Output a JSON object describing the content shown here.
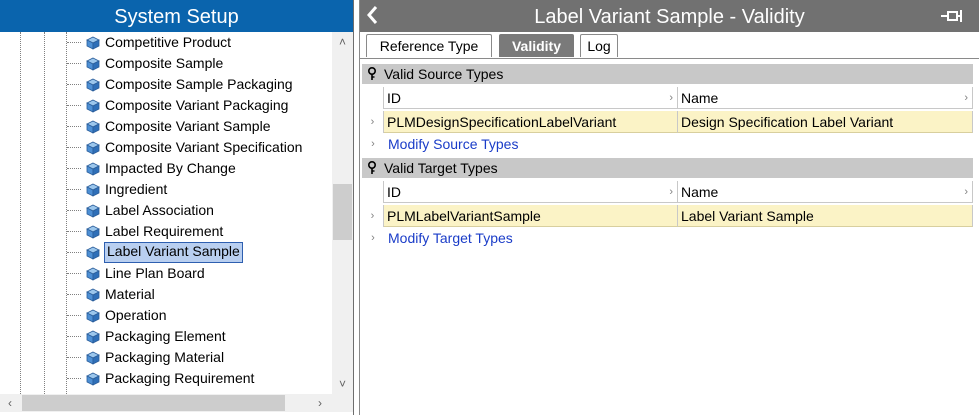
{
  "left_panel": {
    "title": "System Setup",
    "tree_items": [
      {
        "label": "Competitive Product"
      },
      {
        "label": "Composite Sample"
      },
      {
        "label": "Composite Sample Packaging"
      },
      {
        "label": "Composite Variant Packaging"
      },
      {
        "label": "Composite Variant Sample"
      },
      {
        "label": "Composite Variant Specification"
      },
      {
        "label": "Impacted By Change"
      },
      {
        "label": "Ingredient"
      },
      {
        "label": "Label Association"
      },
      {
        "label": "Label Requirement"
      },
      {
        "label": "Label Variant Sample"
      },
      {
        "label": "Line Plan Board"
      },
      {
        "label": "Material"
      },
      {
        "label": "Operation"
      },
      {
        "label": "Packaging Element"
      },
      {
        "label": "Packaging Material"
      },
      {
        "label": "Packaging Requirement"
      }
    ],
    "selected_item": "Label Variant Sample",
    "icon_name": "cube-type-icon"
  },
  "right_panel": {
    "title": "Label Variant Sample - Validity",
    "back_icon": "chevron-left-icon",
    "pin_icon": "pin-icon",
    "tabs": [
      {
        "label": "Reference Type"
      },
      {
        "label": "Validity"
      },
      {
        "label": "Log"
      }
    ],
    "active_tab": "Validity",
    "source": {
      "header": "Valid Source Types",
      "columns": [
        "ID",
        "Name"
      ],
      "rows": [
        {
          "id": "PLMDesignSpecificationLabelVariant",
          "name": "Design Specification Label Variant"
        }
      ],
      "modify_link": "Modify Source Types"
    },
    "target": {
      "header": "Valid Target Types",
      "columns": [
        "ID",
        "Name"
      ],
      "rows": [
        {
          "id": "PLMLabelVariantSample",
          "name": "Label Variant Sample"
        }
      ],
      "modify_link": "Modify Target Types"
    }
  },
  "colors": {
    "left_title_bg": "#0a64ad",
    "right_title_bg": "#717171",
    "row_highlight": "#fbf3c6",
    "link": "#1a3cc8",
    "selection": "#b9cff0"
  }
}
